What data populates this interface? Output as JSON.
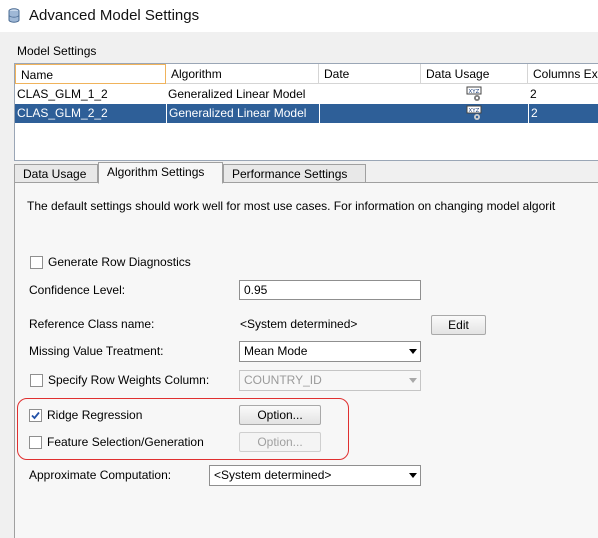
{
  "window": {
    "title": "Advanced Model Settings"
  },
  "model_settings": {
    "label": "Model Settings",
    "columns": [
      "Name",
      "Algorithm",
      "Date",
      "Data Usage",
      "Columns Ex"
    ],
    "rows": [
      {
        "name": "CLAS_GLM_1_2",
        "algorithm": "Generalized Linear Model",
        "date": "",
        "data_usage_icon": "data-usage-icon",
        "columns": "2",
        "selected": false
      },
      {
        "name": "CLAS_GLM_2_2",
        "algorithm": "Generalized Linear Model",
        "date": "",
        "data_usage_icon": "data-usage-icon",
        "columns": "2",
        "selected": true
      }
    ]
  },
  "tabs": [
    {
      "label": "Data Usage",
      "active": false
    },
    {
      "label": "Algorithm Settings",
      "active": true
    },
    {
      "label": "Performance Settings",
      "active": false
    }
  ],
  "algorithm_settings": {
    "intro": "The default settings should work well for most use cases. For information on changing model algorit",
    "generate_row_diagnostics": {
      "label": "Generate Row Diagnostics",
      "checked": false
    },
    "confidence_level": {
      "label": "Confidence Level:",
      "value": "0.95"
    },
    "reference_class": {
      "label": "Reference Class name:",
      "value": "<System determined>",
      "button": "Edit"
    },
    "missing_value_treatment": {
      "label": "Missing Value Treatment:",
      "value": "Mean Mode"
    },
    "row_weights": {
      "label": "Specify Row Weights Column:",
      "checked": false,
      "value": "COUNTRY_ID"
    },
    "ridge_regression": {
      "label": "Ridge Regression",
      "checked": true,
      "button": "Option..."
    },
    "feature_selection": {
      "label": "Feature Selection/Generation",
      "checked": false,
      "button": "Option..."
    },
    "approximate_computation": {
      "label": "Approximate Computation:",
      "value": "<System determined>"
    }
  },
  "colors": {
    "selection": "#2e5f98",
    "highlight": "#e03030",
    "header_focus": "#f0b35b"
  }
}
